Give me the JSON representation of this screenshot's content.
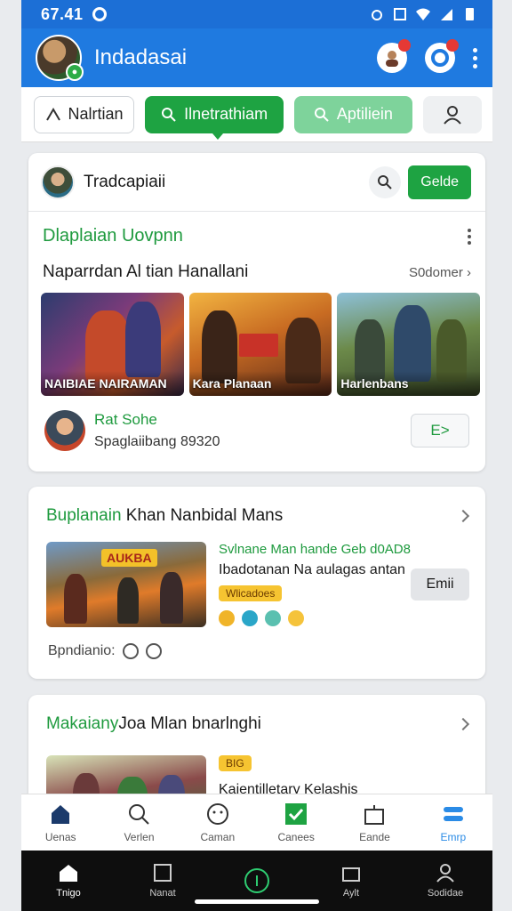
{
  "status_bar": {
    "time": "67.41"
  },
  "app_bar": {
    "title": "Indadasai"
  },
  "filters": {
    "chip1": "Nalrtian",
    "chip2": "Ilnetrathiam",
    "chip3": "Aptiliein"
  },
  "card1": {
    "header_title": "Tradcapiaii",
    "header_button": "Gelde",
    "section_title": "Dlaplaian Uovpnn",
    "sub_title": "Naparrdan Al tian Hanallani",
    "more_label": "S0domer",
    "thumbs": [
      {
        "caption": "NAIBIAE NAIRAMAN"
      },
      {
        "caption": "Kara Planaan"
      },
      {
        "caption": "Harlenbans"
      }
    ],
    "friend": {
      "name": "Rat Sohe",
      "subtitle": "Spaglaiibang 89320",
      "button": "E>"
    }
  },
  "card2": {
    "title_green": "Buplanain",
    "title_dark": " Khan Nanbidal Mans",
    "game": {
      "logo": "AUKBA",
      "headline": "Svlnane Man hande Geb d0AD8",
      "description": "Ibadotanan Na aulagas antan",
      "badge": "Wlicadoes",
      "button": "Emii"
    },
    "footer_label": "Bpndianio:"
  },
  "card3": {
    "title_green": "Makaiany",
    "title_dark": "Joa Mlan bnarlnghi",
    "badge": "BIG",
    "description": "Kajentilletary Kelashis"
  },
  "bottom_nav": [
    {
      "label": "Uenas",
      "icon": "home-icon"
    },
    {
      "label": "Verlen",
      "icon": "search-icon"
    },
    {
      "label": "Caman",
      "icon": "chat-icon"
    },
    {
      "label": "Canees",
      "icon": "checkbox-icon"
    },
    {
      "label": "Eande",
      "icon": "gift-icon"
    },
    {
      "label": "Emrp",
      "icon": "menu-icon"
    }
  ],
  "system_nav": [
    {
      "label": "Tnigo"
    },
    {
      "label": "Nanat"
    },
    {
      "label": "Aylt"
    },
    {
      "label": "Sodidae"
    }
  ],
  "colors": {
    "primary_blue": "#1f7ae0",
    "accent_green": "#1ea342"
  }
}
